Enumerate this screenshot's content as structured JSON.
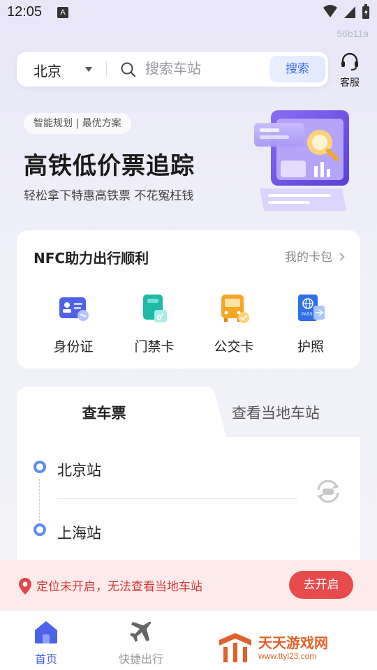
{
  "status_bar": {
    "time": "12:05",
    "notif_letter": "A"
  },
  "build_id": "56b11a",
  "search": {
    "city": "北京",
    "placeholder": "搜索车站",
    "button_label": "搜索"
  },
  "service": {
    "label": "客服"
  },
  "banner": {
    "tag": "智能规划 | 最优方案",
    "title": "高铁低价票追踪",
    "subtitle": "轻松拿下特惠高铁票 不花冤枉钱"
  },
  "nfc": {
    "title": "NFC助力出行顺利",
    "link_label": "我的卡包",
    "items": [
      {
        "label": "身份证",
        "icon": "id-card-icon"
      },
      {
        "label": "门禁卡",
        "icon": "access-card-icon"
      },
      {
        "label": "公交卡",
        "icon": "bus-card-icon"
      },
      {
        "label": "护照",
        "icon": "passport-icon"
      }
    ]
  },
  "ticket": {
    "tabs": [
      "查车票",
      "查看当地车站"
    ],
    "active_tab": 0,
    "from": "北京站",
    "to": "上海站"
  },
  "location_notice": {
    "text": "定位未开启，无法查看当地车站",
    "button_label": "去开启"
  },
  "tab_bar": {
    "items": [
      {
        "label": "首页",
        "icon": "home-icon",
        "active": true
      },
      {
        "label": "快捷出行",
        "icon": "airplane-icon",
        "active": false
      }
    ]
  },
  "watermark": {
    "name": "天天游戏网",
    "url": "www.ttyl23.com"
  },
  "colors": {
    "accent_blue": "#3c6af0",
    "alert_red": "#e84b4b",
    "station_dot": "#5a8ef0"
  }
}
